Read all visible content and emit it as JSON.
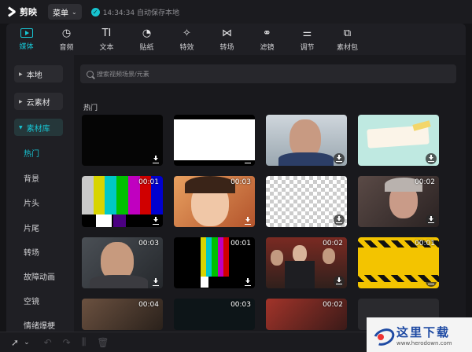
{
  "app": {
    "name": "剪映"
  },
  "topbar": {
    "menu_label": "菜单",
    "save_status": "14:34:34 自动保存本地"
  },
  "toolbar": {
    "tools": [
      {
        "label": "媒体",
        "icon": "media-play-icon",
        "active": true
      },
      {
        "label": "音频",
        "icon": "audio-icon"
      },
      {
        "label": "文本",
        "icon": "text-icon",
        "glyph": "TI"
      },
      {
        "label": "贴纸",
        "icon": "sticker-icon",
        "glyph": "◔"
      },
      {
        "label": "特效",
        "icon": "effects-icon",
        "glyph": "✧"
      },
      {
        "label": "转场",
        "icon": "transition-icon",
        "glyph": "⋈"
      },
      {
        "label": "滤镜",
        "icon": "filter-icon",
        "glyph": "⚭"
      },
      {
        "label": "调节",
        "icon": "adjust-icon",
        "glyph": "⚌"
      },
      {
        "label": "素材包",
        "icon": "material-pack-icon",
        "glyph": "⧉"
      }
    ]
  },
  "sidebar": {
    "items": [
      {
        "label": "本地"
      },
      {
        "label": "云素材"
      },
      {
        "label": "素材库",
        "active": true
      }
    ],
    "sub_items": [
      "热门",
      "背景",
      "片头",
      "片尾",
      "转场",
      "故障动画",
      "空镜",
      "情绪爆梗"
    ]
  },
  "search": {
    "placeholder": "搜索视频场景/元素"
  },
  "section": {
    "title": "热门"
  },
  "thumbnails": [
    {
      "kind": "black",
      "duration": ""
    },
    {
      "kind": "white",
      "duration": ""
    },
    {
      "kind": "man-face",
      "duration": ""
    },
    {
      "kind": "note-card",
      "duration": ""
    },
    {
      "kind": "color-bars",
      "duration": "00:01"
    },
    {
      "kind": "woman-laugh",
      "duration": "00:03"
    },
    {
      "kind": "checker",
      "duration": ""
    },
    {
      "kind": "old-woman",
      "duration": "00:02"
    },
    {
      "kind": "man-laugh",
      "duration": "00:03"
    },
    {
      "kind": "color-bars-small",
      "duration": "00:01"
    },
    {
      "kind": "crowd",
      "duration": "00:02"
    },
    {
      "kind": "hazard-stripes",
      "duration": "00:01"
    },
    {
      "kind": "partial-1",
      "duration": "00:04"
    },
    {
      "kind": "partial-2",
      "duration": "00:03"
    },
    {
      "kind": "partial-3",
      "duration": "00:02"
    },
    {
      "kind": "partial-4",
      "duration": ""
    }
  ],
  "watermark": {
    "title": "这里下载",
    "url": "www.herodown.com"
  }
}
